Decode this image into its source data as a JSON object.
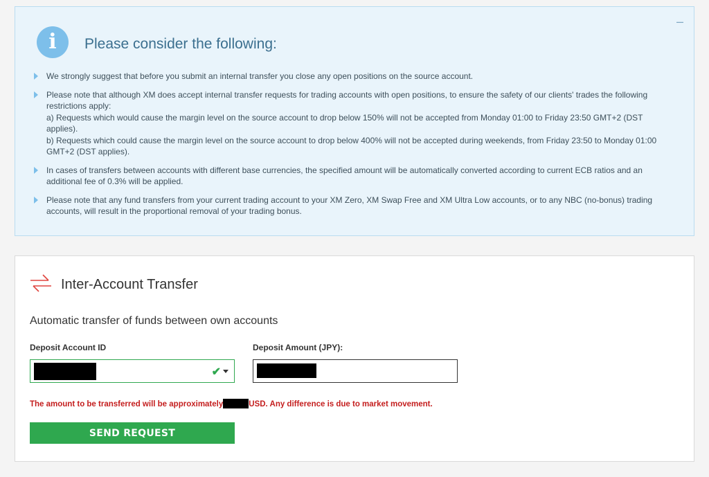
{
  "info": {
    "title": "Please consider the following:",
    "collapse_label": "–",
    "icon_letter": "i",
    "items": [
      [
        "We strongly suggest that before you submit an internal transfer you close any open positions on the source account."
      ],
      [
        "Please note that although XM does accept internal transfer requests for trading accounts with open positions, to ensure the safety of our clients' trades the following restrictions apply:",
        "a) Requests which would cause the margin level on the source account to drop below 150% will not be accepted from Monday 01:00 to Friday 23:50 GMT+2 (DST applies).",
        "b) Requests which could cause the margin level on the source account to drop below 400% will not be accepted during weekends, from Friday 23:50 to Monday 01:00 GMT+2 (DST applies)."
      ],
      [
        "In cases of transfers between accounts with different base currencies, the specified amount will be automatically converted according to current ECB ratios and an additional fee of 0.3% will be applied."
      ],
      [
        "Please note that any fund transfers from your current trading account to your XM Zero, XM Swap Free and XM Ultra Low accounts, or to any NBC (no-bonus) trading accounts, will result in the proportional removal of your trading bonus."
      ]
    ]
  },
  "transfer": {
    "title": "Inter-Account Transfer",
    "subtitle": "Automatic transfer of funds between own accounts",
    "account_label": "Deposit Account ID",
    "amount_label": "Deposit Amount (JPY):",
    "warning_before": "The amount to be transferred will be approximately",
    "warning_after": "USD. Any difference is due to market movement.",
    "send_label": "SEND REQUEST"
  },
  "colors": {
    "accent_green": "#2fa84f",
    "info_blue": "#7dbfea",
    "warning_red": "#c41e1e",
    "transfer_icon_red": "#e0443e"
  }
}
